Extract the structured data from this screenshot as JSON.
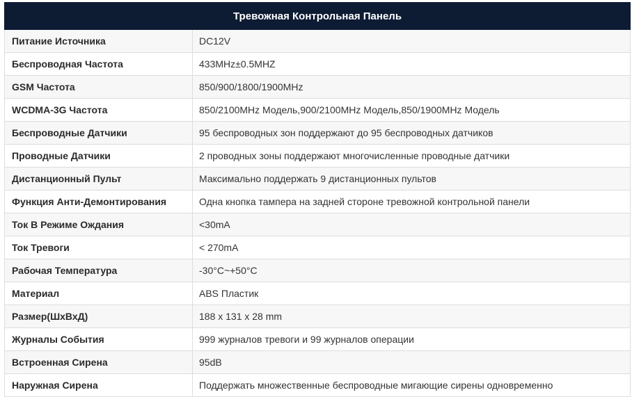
{
  "table": {
    "title": "Тревожная Контрольная Панель",
    "rows": [
      {
        "label": "Питание Источника",
        "value": "DC12V"
      },
      {
        "label": "Беспроводная Частота",
        "value": "433MHz±0.5MHZ"
      },
      {
        "label": "GSM Частота",
        "value": "850/900/1800/1900MHz"
      },
      {
        "label": "WCDMA-3G Частота",
        "value": "850/2100MHz Модель,900/2100MHz Модель,850/1900MHz Модель"
      },
      {
        "label": "Беспроводные Датчики",
        "value": "95 беспроводных зон поддержают до 95 беспроводных датчиков"
      },
      {
        "label": "Проводные Датчики",
        "value": "2 проводных зоны поддержают многочисленные проводные датчики"
      },
      {
        "label": "Дистанционный Пульт",
        "value": "Максимально поддержать 9 дистанционных пультов"
      },
      {
        "label": "Функция Анти-Демонтирования",
        "value": "Одна кнопка тампера на задней стороне тревожной контрольной панели"
      },
      {
        "label": "Ток В Режиме Ождания",
        "value": "<30mA"
      },
      {
        "label": "Ток Тревоги",
        "value": "< 270mA"
      },
      {
        "label": "Рабочая Температура",
        "value": "-30°C~+50°C"
      },
      {
        "label": "Материал",
        "value": "ABS Пластик"
      },
      {
        "label": "Размер(ШхВхД)",
        "value": "188 x 131 x 28 mm"
      },
      {
        "label": "Журналы События",
        "value": "999 журналов тревоги и 99 журналов операции"
      },
      {
        "label": "Встроенная Сирена",
        "value": "95dB"
      },
      {
        "label": "Наружная Сирена",
        "value": "Поддержать множественные беспроводные мигающие сирены одновременно"
      }
    ]
  }
}
